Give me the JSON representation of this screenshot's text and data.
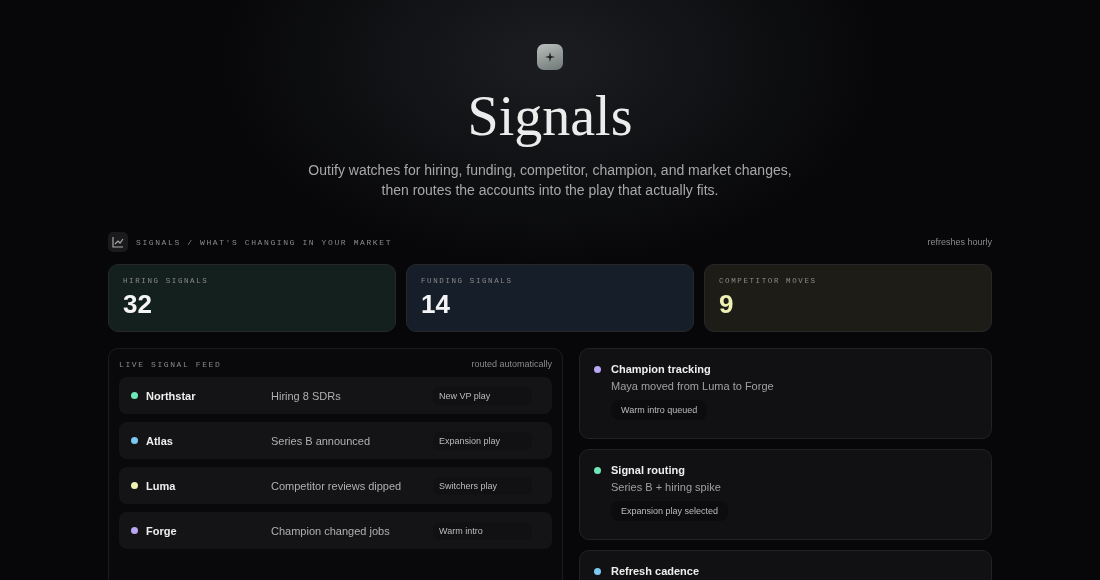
{
  "hero": {
    "title": "Signals",
    "subtitle": "Outify watches for hiring, funding, competitor, champion, and market changes, then routes the accounts into the play that actually fits."
  },
  "section": {
    "label": "SIGNALS / WHAT'S CHANGING IN YOUR MARKET",
    "note": "refreshes hourly"
  },
  "stats": [
    {
      "label": "HIRING SIGNALS",
      "value": "32",
      "color": "#14201d",
      "accent": false
    },
    {
      "label": "FUNDING SIGNALS",
      "value": "14",
      "color": "#161e29",
      "accent": false
    },
    {
      "label": "COMPETITOR MOVES",
      "value": "9",
      "color": "#1d1c17",
      "accent": true
    }
  ],
  "feed": {
    "title": "LIVE SIGNAL FEED",
    "note": "routed automatically",
    "rows": [
      {
        "account": "Northstar",
        "event": "Hiring 8 SDRs",
        "play": "New VP play",
        "color": "#6ee7b7"
      },
      {
        "account": "Atlas",
        "event": "Series B announced",
        "play": "Expansion play",
        "color": "#7cc8f2"
      },
      {
        "account": "Luma",
        "event": "Competitor reviews dipped",
        "play": "Switchers play",
        "color": "#eef0b4"
      },
      {
        "account": "Forge",
        "event": "Champion changed jobs",
        "play": "Warm intro",
        "color": "#b9a6f5"
      }
    ]
  },
  "cards": [
    {
      "title": "Champion tracking",
      "detail": "Maya moved from Luma to Forge",
      "status": "Warm intro queued",
      "color": "#b9a6f5"
    },
    {
      "title": "Signal routing",
      "detail": "Series B + hiring spike",
      "status": "Expansion play selected",
      "color": "#6ee7b7"
    },
    {
      "title": "Refresh cadence",
      "color": "#7cc8f2"
    }
  ]
}
